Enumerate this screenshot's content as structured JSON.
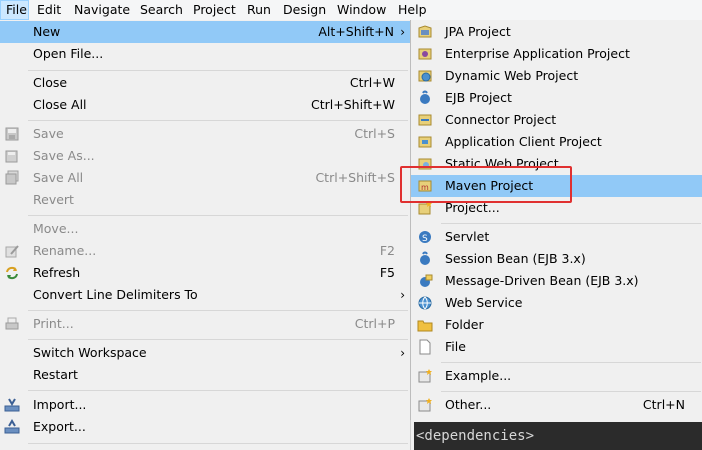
{
  "menubar": {
    "items": [
      "File",
      "Edit",
      "Navigate",
      "Search",
      "Project",
      "Run",
      "Design",
      "Window",
      "Help"
    ]
  },
  "file_menu": {
    "new": {
      "label": "New",
      "shortcut": "Alt+Shift+N"
    },
    "open_file": {
      "label": "Open File..."
    },
    "close": {
      "label": "Close",
      "shortcut": "Ctrl+W"
    },
    "close_all": {
      "label": "Close All",
      "shortcut": "Ctrl+Shift+W"
    },
    "save": {
      "label": "Save",
      "shortcut": "Ctrl+S"
    },
    "save_as": {
      "label": "Save As..."
    },
    "save_all": {
      "label": "Save All",
      "shortcut": "Ctrl+Shift+S"
    },
    "revert": {
      "label": "Revert"
    },
    "move": {
      "label": "Move..."
    },
    "rename": {
      "label": "Rename...",
      "shortcut": "F2"
    },
    "refresh": {
      "label": "Refresh",
      "shortcut": "F5"
    },
    "convert": {
      "label": "Convert Line Delimiters To"
    },
    "print": {
      "label": "Print...",
      "shortcut": "Ctrl+P"
    },
    "switch_workspace": {
      "label": "Switch Workspace"
    },
    "restart": {
      "label": "Restart"
    },
    "import": {
      "label": "Import..."
    },
    "export": {
      "label": "Export..."
    }
  },
  "new_submenu": {
    "jpa": {
      "label": "JPA Project"
    },
    "enterprise": {
      "label": "Enterprise Application Project"
    },
    "dynamic_web": {
      "label": "Dynamic Web Project"
    },
    "ejb": {
      "label": "EJB Project"
    },
    "connector": {
      "label": "Connector Project"
    },
    "app_client": {
      "label": "Application Client Project"
    },
    "static_web": {
      "label": "Static Web Project"
    },
    "maven": {
      "label": "Maven Project"
    },
    "project": {
      "label": "Project..."
    },
    "servlet": {
      "label": "Servlet"
    },
    "session_bean": {
      "label": "Session Bean (EJB 3.x)"
    },
    "mdb": {
      "label": "Message-Driven Bean (EJB 3.x)"
    },
    "web_service": {
      "label": "Web Service"
    },
    "folder": {
      "label": "Folder"
    },
    "file": {
      "label": "File"
    },
    "example": {
      "label": "Example..."
    },
    "other": {
      "label": "Other...",
      "shortcut": "Ctrl+N"
    }
  },
  "editor": {
    "text": "<dependencies>"
  },
  "colors": {
    "highlight": "#91c9f7",
    "menubar_active": "#cce8ff",
    "annotation": "#e03030",
    "editor_bg": "#2b2b2b"
  }
}
